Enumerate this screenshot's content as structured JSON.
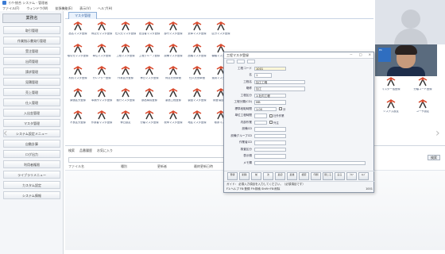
{
  "window": {
    "title": "ｾﾝｻｰ統合 システム - 管理者"
  },
  "menu": [
    "ファイル(F)",
    "ウィンドウ(W)",
    "拡張機能(E)",
    "表示(V)",
    "ヘルプ(H)"
  ],
  "sidebar": {
    "title": "業務名",
    "items": [
      "取引管理",
      "作業指示書発行管理",
      "受注管理",
      "出荷管理",
      "請求管理",
      "見積管理",
      "売上管理",
      "仕入管理",
      "入出金管理",
      "マスタ管理",
      "システム設定メニュー",
      "自動計算",
      "ログ出力",
      "利用者権限",
      "ライブラリメニュー",
      "カスタム設定",
      "システム情報"
    ]
  },
  "main": {
    "tab_label": "マスタ管理"
  },
  "icons": [
    "品名マスタ登録",
    "得意先マスタ登録",
    "仕入先マスタ登録",
    "担当者マスタ登録",
    "部門マスタ登録",
    "倉庫マスタ登録",
    "区分マスタ登録",
    "取引先マスタ登録",
    "単位マスタ登録",
    "工程マスタ登録",
    "工程グループ登録",
    "設備マスタ登録",
    "品種マスタ登録",
    "機種マスタ登録",
    "材質マスタ登録",
    "カレンダー登録",
    "作業区分登録",
    "休日マスタ登録",
    "得意先別単価",
    "仕入先別単価",
    "運賃マスタ登録",
    "原価区分登録",
    "事業所マスタ登録",
    "銀行マスタ登録",
    "部品構成登録",
    "製造工程登録",
    "製品マスタ登録",
    "検査項目登録",
    "不良区分登録",
    "作業者マスタ登録",
    "休日設定",
    "分類マスタ登録",
    "税率マスタ登録",
    "地区マスタ登録",
    "帳票マスタ"
  ],
  "right_icons": [
    "マスタ一括登録",
    "分類コード登録",
    "システム設定",
    "ユーザ設定"
  ],
  "bottom": {
    "tabs": [
      "検索",
      "品番履歴",
      "お気に入り"
    ],
    "search_button": "検索",
    "columns": [
      "ファイル名",
      "種別",
      "更新者",
      "最終更新日時",
      "実行"
    ]
  },
  "dialog": {
    "title": "工程マスタ登録",
    "window_controls": [
      "－",
      "□",
      "×"
    ],
    "fields": [
      {
        "label": "工程コード",
        "value": "1001",
        "width": 40,
        "yellow": true
      },
      {
        "label": "名",
        "value": "1",
        "width": 22,
        "yellow": false
      },
      {
        "label": "工程名",
        "value": "加工工程",
        "width": 64,
        "yellow": false
      },
      {
        "label": "略称",
        "value": "加工",
        "width": 64,
        "yellow": false
      },
      {
        "label": "工程区分",
        "value": "1:社内工程",
        "width": 40,
        "yellow": false
      },
      {
        "label": "工程分類(CD)",
        "value": "MB",
        "width": 40,
        "yellow": false
      },
      {
        "label": "標準段取時間",
        "value": "1.00",
        "width": 28,
        "yellow": false,
        "extra": "分"
      },
      {
        "label": "単位工程時間",
        "value": "",
        "width": 16,
        "yellow": false,
        "extra": "社外作業"
      },
      {
        "label": "内部作業",
        "value": "",
        "width": 16,
        "yellow": false,
        "extra": "外注"
      },
      {
        "label": "設備CD",
        "value": "",
        "width": 40,
        "yellow": false
      },
      {
        "label": "設備グループCD",
        "value": "",
        "width": 40,
        "yellow": false
      },
      {
        "label": "作業者CD",
        "value": "",
        "width": 40,
        "yellow": false
      },
      {
        "label": "検査区分",
        "value": "",
        "width": 40,
        "yellow": false
      },
      {
        "label": "表示順",
        "value": "",
        "width": 40,
        "yellow": false
      },
      {
        "label": "メモ欄",
        "value": "",
        "width": 140,
        "yellow": false
      }
    ],
    "buttons": [
      "登録",
      "削除",
      "前",
      "次",
      "最初",
      "最後",
      "検索",
      "印刷",
      "閉じる",
      "戻る",
      "ｸﾘｱ",
      "ﾍﾙﾌﾟ"
    ],
    "status_line1": "ガイド： 必須入力項目を入力してください。（必須項目です）",
    "status_line2": "F1:ヘルプ  F8:登録  F9:検索  Shift+F8:削除",
    "status_right": "1001"
  },
  "video": {
    "self_label": "PC"
  },
  "colors": {
    "icon_accent": "#d94a2e",
    "icon_dark": "#333333",
    "tab_blue": "#3b66a3",
    "sidebar_bg": "#f4f6f9"
  }
}
